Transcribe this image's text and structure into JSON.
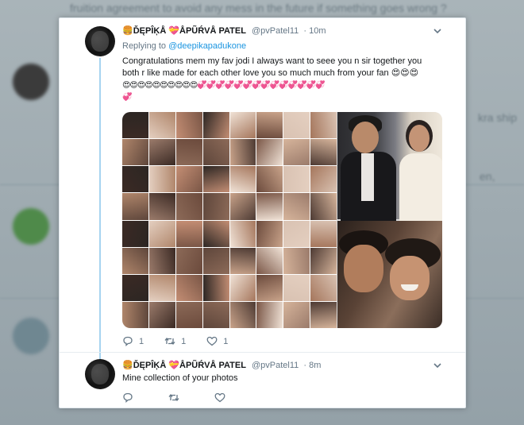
{
  "background": {
    "top_text": "fruition agreement to avoid any mess in the future if something goes wrong ?",
    "right_snippets": [
      "kra ship",
      "en,"
    ]
  },
  "tweet1": {
    "display_name": "🍔ĎĘPÎĶÅ 💝ÅPŨŔVÅ PATEL",
    "handle": "@pvPatel11",
    "time": "· 10m",
    "replying_prefix": "Replying to",
    "replying_to": "@deepikapadukone",
    "text_line1": "Congratulations  mem my fav jodi  I always want to seee you n sir together  you",
    "text_line2": "both r like made for each other love you so much much from your fan 😍😍😍",
    "emoji_line1": "😍😍😍😍😍😍😍😍😍😍💞💞💞💞💞💞💞💞💞💞💞💞💞💞",
    "emoji_line2": "💞",
    "reply_count": "1",
    "retweet_count": "1",
    "like_count": "1"
  },
  "tweet2": {
    "display_name": "🍔ĎĘPÎĶÅ 💝ÅPŨŔVÅ PATEL",
    "handle": "@pvPatel11",
    "time": "· 8m",
    "text": "Mine collection  of your photos"
  },
  "colors": {
    "link": "#1b95e0",
    "secondary_text": "#657786",
    "thread_line": "#a7d4f0"
  },
  "icons": [
    "reply-icon",
    "retweet-icon",
    "like-icon",
    "chevron-down-icon"
  ]
}
